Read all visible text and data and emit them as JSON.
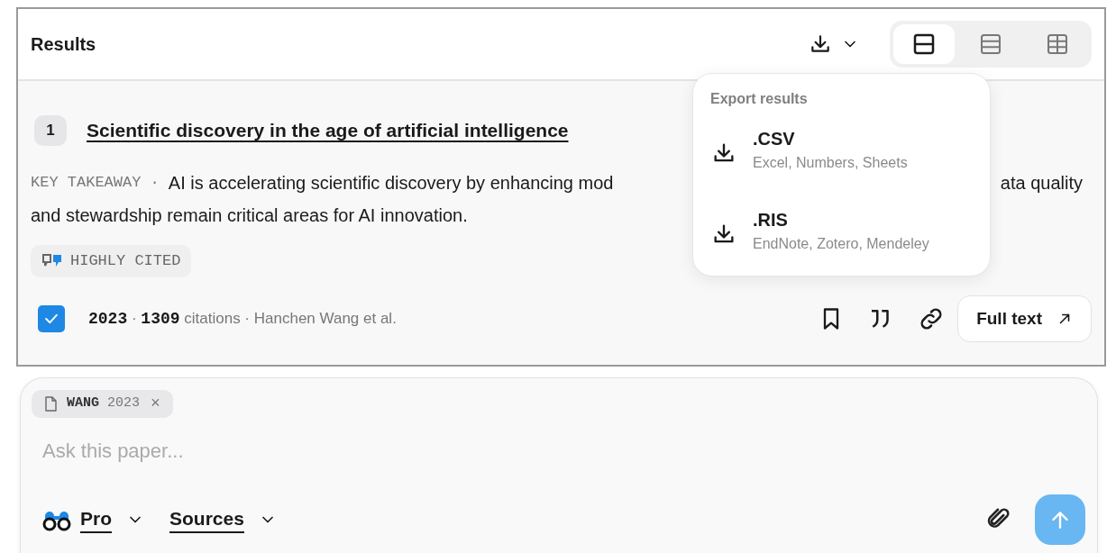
{
  "header": {
    "title": "Results",
    "view_modes": [
      {
        "selected": true
      },
      {
        "selected": false
      },
      {
        "selected": false
      }
    ]
  },
  "export_menu": {
    "heading": "Export results",
    "items": [
      {
        "label": ".CSV",
        "description": "Excel, Numbers, Sheets"
      },
      {
        "label": ".RIS",
        "description": "EndNote, Zotero, Mendeley"
      }
    ]
  },
  "results": [
    {
      "index": "1",
      "title": "Scientific discovery in the age of artificial intelligence",
      "takeaway_label": "KEY TAKEAWAY ·",
      "takeaway_visible_parts": [
        "AI is accelerating scientific discovery by enhancing mod",
        "ata quality"
      ],
      "takeaway_line_2": "and stewardship remain critical areas for AI innovation.",
      "badge": "HIGHLY CITED",
      "checked": true,
      "meta": "**2023** · **1309** citations · Hanchen Wang et al.",
      "full_text_button": "Full text"
    }
  ],
  "composer": {
    "attachment": "**WANG** 2023",
    "attachment_close": "×",
    "placeholder": "Ask this paper...",
    "mode_button": "Pro",
    "sources_button": "Sources"
  }
}
